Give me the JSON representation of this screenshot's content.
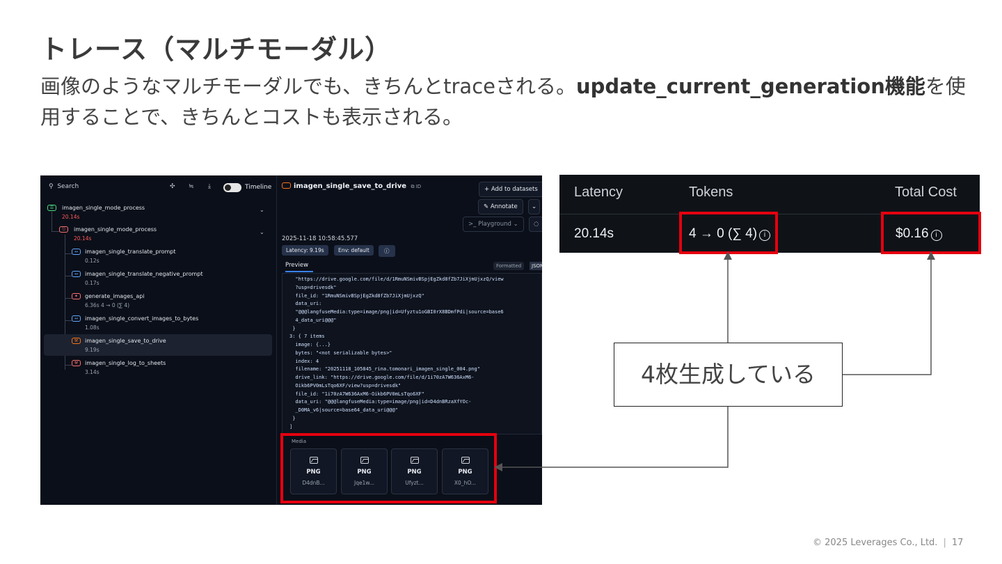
{
  "slide": {
    "title": "トレース（マルチモーダル）",
    "subtitle_part1": "画像のようなマルチモーダルでも、きちんとtraceされる。",
    "subtitle_bold": "update_current_generation機能",
    "subtitle_part2": "を使用することで、きちんとコストも表示される。",
    "callout": "4枚生成している",
    "footer_copyright": "© 2025 Leverages Co., Ltd.",
    "footer_page": "17"
  },
  "trace_panel": {
    "search_placeholder": "Search",
    "timeline_label": "Timeline",
    "nodes": [
      {
        "name": "imagen_single_mode_process",
        "duration": "20.14s"
      },
      {
        "name": "imagen_single_mode_process",
        "duration": "20.14s"
      },
      {
        "name": "imagen_single_translate_prompt",
        "duration": "0.12s"
      },
      {
        "name": "imagen_single_translate_negative_prompt",
        "duration": "0.17s"
      },
      {
        "name": "generate_images_api",
        "duration": "6.36s  4 → 0 (∑ 4)"
      },
      {
        "name": "imagen_single_convert_images_to_bytes",
        "duration": "1.08s"
      },
      {
        "name": "imagen_single_save_to_drive",
        "duration": "9.19s"
      },
      {
        "name": "imagen_single_log_to_sheets",
        "duration": "3.14s"
      }
    ]
  },
  "detail_panel": {
    "title": "imagen_single_save_to_drive",
    "id_label": "ID",
    "add_to_datasets": "+ Add to datasets",
    "annotate": "Annotate",
    "playground": ">_ Playground",
    "timestamp": "2025-11-18 10:58:45.577",
    "latency_pill": "Latency: 9.19s",
    "env_pill": "Env: default",
    "preview_tab": "Preview",
    "formatted_tab": "Formatted",
    "json_tab": "JSON",
    "code_lines": [
      "  \"https://drive.google.com/file/d/1RmuNSmivBSpjEgZkd8fZb7JiXjmUjxzQ/view",
      "  ?usp=drivesdk\"",
      "  file_id: \"1RmuNSmivBSpjEgZkd8fZb7JiXjmUjxzQ\"",
      "  data_uri:",
      "  \"@@@langfuseMedia:type=image/png|id=Ufyztu1oGBI0rX8BDmfPdi|source=base6",
      "  4_data_uri@@@\"",
      " }",
      "3: { 7 items",
      "  image: {...}",
      "  bytes: \"<not serializable bytes>\"",
      "  index: 4",
      "  filename: \"20251118_105845_rina.tomonari_imagen_single_004.png\"",
      "  drive_link: \"https://drive.google.com/file/d/1i70zA7W636AxM6-",
      "  Oikb6PV0mLsTqo6XF/view?usp=drivesdk\"",
      "  file_id: \"1i70zA7W636AxM6-Oikb6PV0mLsTqo6XF\"",
      "  data_uri: \"@@@langfuseMedia:type=image/png|id=D4dnBRzaXfYOc-",
      "  _D0MA_v6|source=base64_data_uri@@@\"",
      " }",
      "]"
    ],
    "media_label": "Media",
    "media": [
      {
        "type": "PNG",
        "name": "D4dnB..."
      },
      {
        "type": "PNG",
        "name": "Jqe1w..."
      },
      {
        "type": "PNG",
        "name": "Ufyzt..."
      },
      {
        "type": "PNG",
        "name": "X0_hO..."
      }
    ]
  },
  "metrics": {
    "latency_header": "Latency",
    "tokens_header": "Tokens",
    "cost_header": "Total Cost",
    "latency_value": "20.14s",
    "tokens_value": "4 → 0 (∑ 4)",
    "cost_value": "$0.16"
  }
}
